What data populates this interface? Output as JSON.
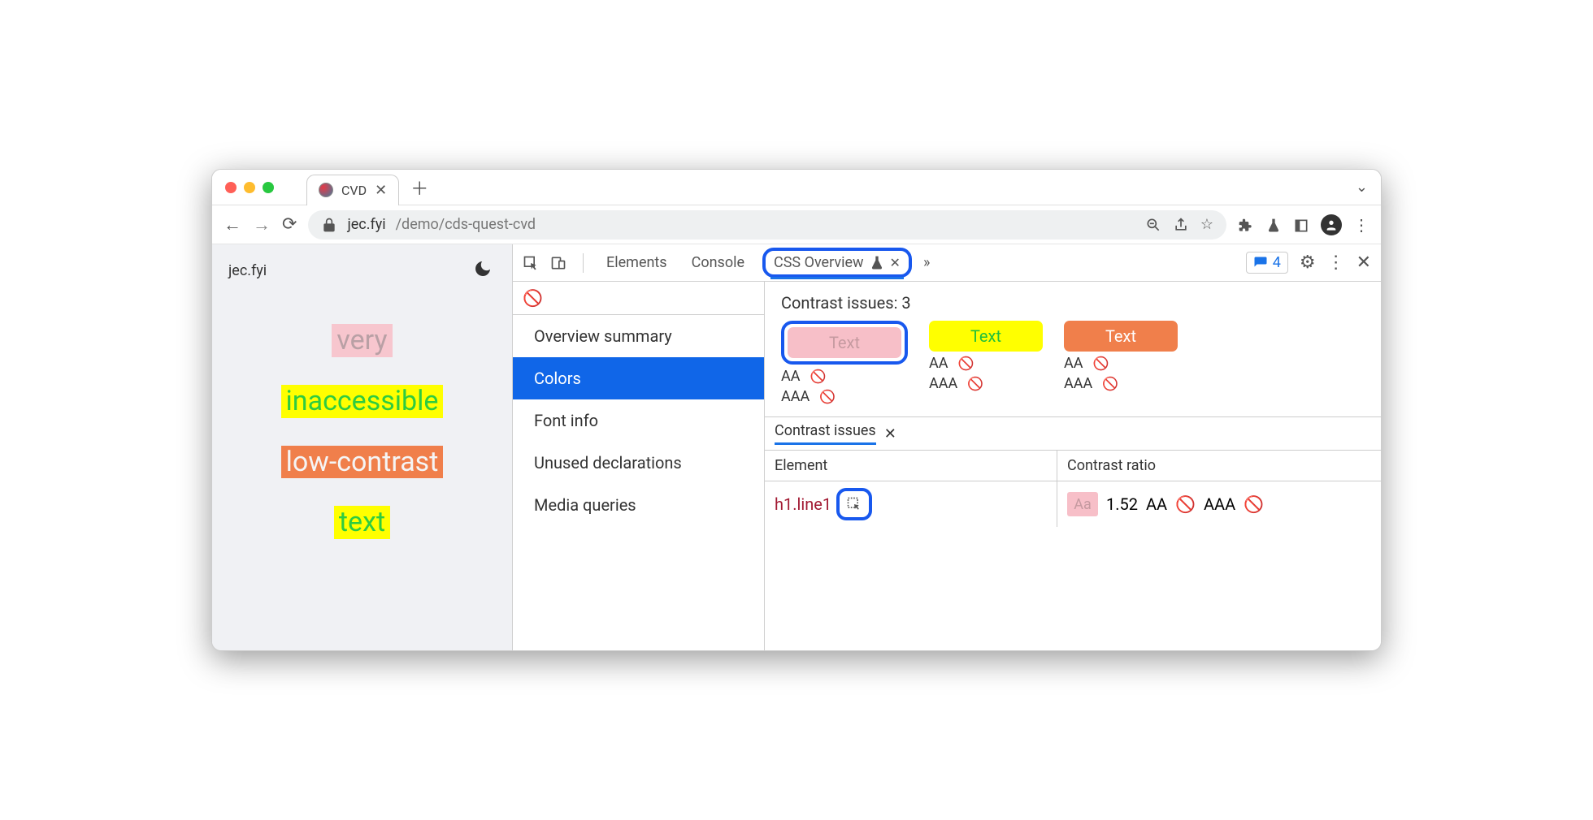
{
  "browser": {
    "tab_title": "CVD",
    "url_domain": "jec.fyi",
    "url_path": "/demo/cds-quest-cvd"
  },
  "page": {
    "site_label": "jec.fyi",
    "words": [
      "very",
      "inaccessible",
      "low-contrast",
      "text"
    ]
  },
  "devtools": {
    "tabs": {
      "elements": "Elements",
      "console": "Console",
      "css_overview": "CSS Overview"
    },
    "issues_count": "4",
    "sidebar": {
      "items": [
        "Overview summary",
        "Colors",
        "Font info",
        "Unused declarations",
        "Media queries"
      ],
      "selected_index": 1
    },
    "contrast_heading": "Contrast issues: 3",
    "swatches": {
      "label": "Text",
      "aa": "AA",
      "aaa": "AAA"
    },
    "issues_tab": "Contrast issues",
    "table": {
      "col_element": "Element",
      "col_ratio": "Contrast ratio",
      "row": {
        "element": "h1.line1",
        "sample": "Aa",
        "ratio": "1.52",
        "aa": "AA",
        "aaa": "AAA"
      }
    }
  }
}
